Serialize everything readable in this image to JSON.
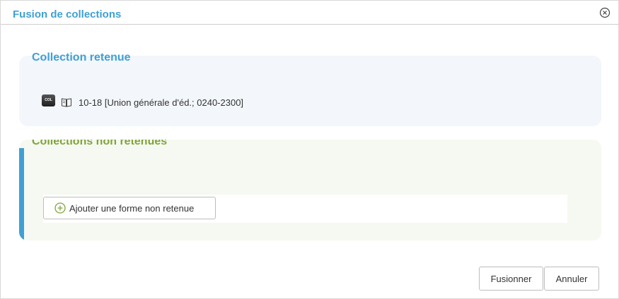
{
  "dialog": {
    "title": "Fusion de collections",
    "close_icon": "close-circle-icon"
  },
  "retained": {
    "legend": "Collection retenue",
    "badge": "COL",
    "type_icon": "book-icon",
    "collection": "10-18 [Union générale d'éd.; 0240-2300]"
  },
  "non_retained": {
    "legend": "Collections non retenues",
    "add_button": "Ajouter une forme non retenue",
    "add_icon": "plus-circle-icon"
  },
  "footer": {
    "merge_button": "Fusionner",
    "cancel_button": "Annuler"
  },
  "colors": {
    "title_blue": "#3fa0d4",
    "green": "#7fa43a"
  }
}
